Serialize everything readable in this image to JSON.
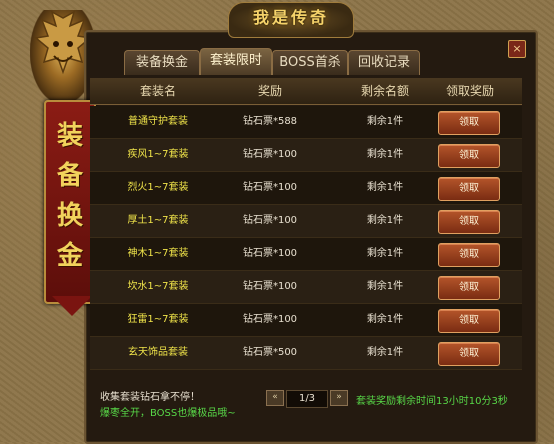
{
  "window": {
    "title": "我是传奇",
    "close_label": "×"
  },
  "banner": {
    "chars": [
      "装",
      "备",
      "换",
      "金"
    ]
  },
  "tabs": [
    {
      "label": "装备换金",
      "active": false
    },
    {
      "label": "套装限时",
      "active": true
    },
    {
      "label": "BOSS首杀",
      "active": false
    },
    {
      "label": "回收记录",
      "active": false
    }
  ],
  "table": {
    "headers": {
      "name": "套装名",
      "reward": "奖励",
      "remaining": "剩余名额",
      "claim": "领取奖励"
    },
    "rows": [
      {
        "name": "普通守护套装",
        "reward": "钻石票*588",
        "remaining": "剩余1件",
        "button": "领取"
      },
      {
        "name": "疾风1~7套装",
        "reward": "钻石票*100",
        "remaining": "剩余1件",
        "button": "领取"
      },
      {
        "name": "烈火1~7套装",
        "reward": "钻石票*100",
        "remaining": "剩余1件",
        "button": "领取"
      },
      {
        "name": "厚土1~7套装",
        "reward": "钻石票*100",
        "remaining": "剩余1件",
        "button": "领取"
      },
      {
        "name": "神木1~7套装",
        "reward": "钻石票*100",
        "remaining": "剩余1件",
        "button": "领取"
      },
      {
        "name": "坎水1~7套装",
        "reward": "钻石票*100",
        "remaining": "剩余1件",
        "button": "领取"
      },
      {
        "name": "狂雷1~7套装",
        "reward": "钻石票*100",
        "remaining": "剩余1件",
        "button": "领取"
      },
      {
        "name": "玄天饰品套装",
        "reward": "钻石票*500",
        "remaining": "剩余1件",
        "button": "领取"
      }
    ]
  },
  "footer": {
    "line1": "收集套装钻石拿不停！",
    "line2": "爆枣全开，BOSS也爆极品哦~",
    "page": "1/3",
    "prev": "«",
    "next": "»",
    "timer": "套装奖励剩余时间13小时10分3秒"
  },
  "colors": {
    "accent_gold": "#f6d36a",
    "item_name": "#f0e44a",
    "timer_green": "#58d848",
    "button": "#b4552a"
  },
  "icons": {
    "dragon": "dragon-head-icon",
    "close": "close-icon",
    "prev": "double-chevron-left-icon",
    "next": "double-chevron-right-icon"
  }
}
